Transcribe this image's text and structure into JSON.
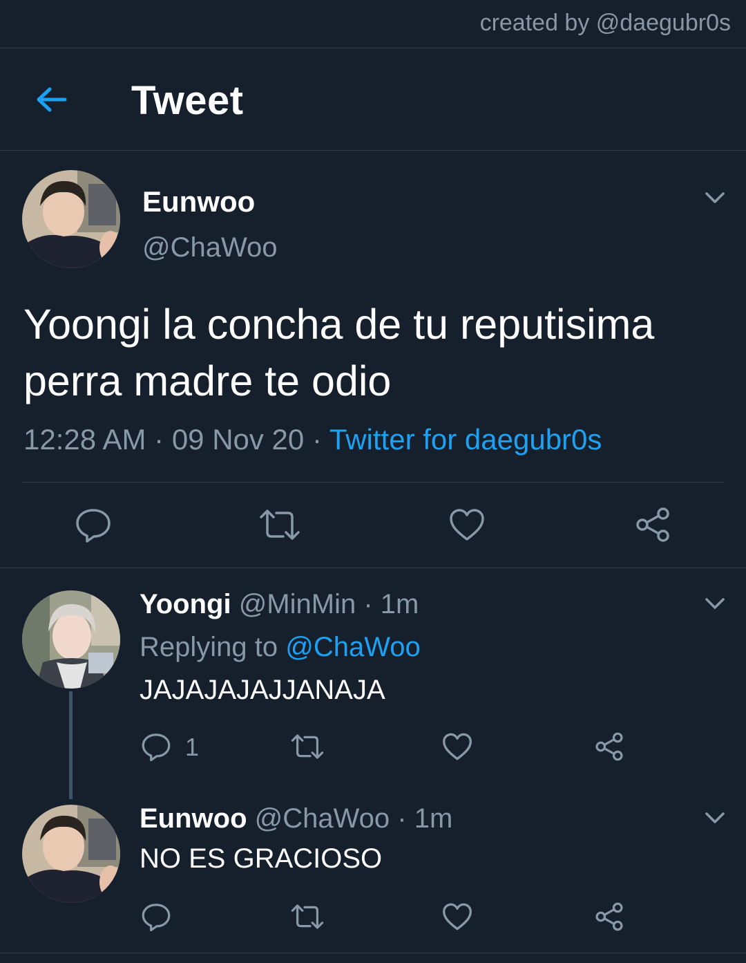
{
  "credit": "created by @daegubr0s",
  "header": {
    "title": "Tweet"
  },
  "main_tweet": {
    "name": "Eunwoo",
    "handle": "@ChaWoo",
    "text_line1": "Yoongi la concha de tu reputisima",
    "text_line2": "perra madre te odio",
    "time": "12:28 AM",
    "date": "09 Nov 20",
    "dot": "·",
    "source": "Twitter for daegubr0s"
  },
  "replies": [
    {
      "name": "Yoongi",
      "handle": "@MinMin",
      "time": "1m",
      "replying_prefix": "Replying to",
      "replying_handle": "@ChaWoo",
      "text": "JAJAJAJAJJANAJA",
      "reply_count": "1"
    },
    {
      "name": "Eunwoo",
      "handle": "@ChaWoo",
      "time": "1m",
      "text": "NO ES GRACIOSO"
    }
  ],
  "icons": {
    "back": "arrow-left-icon",
    "caret": "chevron-down-icon",
    "reply": "reply-icon",
    "retweet": "retweet-icon",
    "like": "heart-icon",
    "share": "share-icon"
  },
  "colors": {
    "background": "#16202c",
    "accent": "#1da1f2",
    "muted": "#8899a6",
    "divider": "#2f3b47"
  }
}
